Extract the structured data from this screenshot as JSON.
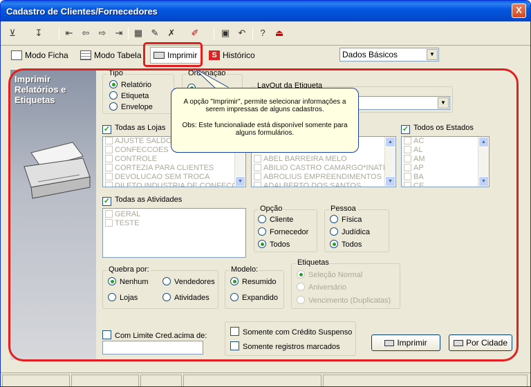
{
  "window": {
    "title": "Cadastro de Clientes/Fornecedores",
    "close_glyph": "X"
  },
  "toolbar": {
    "icons": [
      "filter-icon",
      "sort-icon",
      "first-icon",
      "prev-icon",
      "next-icon",
      "last-icon",
      "calculator-icon",
      "edit-icon",
      "delete-icon",
      "brush-icon",
      "save-icon",
      "undo-icon",
      "help-icon",
      "exit-icon"
    ]
  },
  "tabs": {
    "modo_ficha": "Modo Ficha",
    "modo_tabela": "Modo Tabela",
    "imprimir": "Imprimir",
    "historico": "Histórico"
  },
  "view_select": {
    "value": "Dados Básicos"
  },
  "side_panel": {
    "line1": "Imprimir",
    "line2": "Relatórios e",
    "line3": "Etiquetas"
  },
  "tipo": {
    "label": "Tipo",
    "options": [
      "Relatório",
      "Etiqueta",
      "Envelope"
    ],
    "selected": "Relatório"
  },
  "ordenacao": {
    "label": "Ordenação"
  },
  "layout": {
    "label": "LayOut da Etiqueta",
    "value": ""
  },
  "tooltip": {
    "line1": "A opção \"Imprimir\", permite selecionar informações a serem impressas de alguns cadastros.",
    "line2": "Obs: Este funcionaliade está disponível somente para alguns formulários."
  },
  "lojas": {
    "check_label": "Todas as Lojas",
    "checked": true,
    "items": [
      "AJUSTE SALDO",
      "CONFECCOES",
      "CONTROLE",
      "CORTEZIA PARA CLIENTES",
      "DEVOLUCAO SEM TROCA",
      "DILETO INDUSTRIA DE CONFECC"
    ]
  },
  "clientes": {
    "items": [
      "ABEL BARREIRA MELO",
      "ABILIO CASTRO CAMARGO*INATIV",
      "ABROLIUS EMPREENDIMENTOS LT",
      "ADALBERTO DOS SANTOS"
    ]
  },
  "estados": {
    "check_label": "Todos os Estados",
    "checked": true,
    "items": [
      "AC",
      "AL",
      "AM",
      "AP",
      "BA",
      "CE"
    ]
  },
  "atividades": {
    "check_label": "Todas as Atividades",
    "checked": true,
    "items": [
      "GERAL",
      "TESTE"
    ]
  },
  "opcao": {
    "label": "Opção",
    "options": [
      "Cliente",
      "Fornecedor",
      "Todos"
    ],
    "selected": "Todos"
  },
  "pessoa": {
    "label": "Pessoa",
    "options": [
      "Física",
      "Judídica",
      "Todos"
    ],
    "selected": "Todos"
  },
  "quebra": {
    "label": "Quebra por:",
    "options": [
      "Nenhum",
      "Vendedores",
      "Lojas",
      "Atividades"
    ],
    "selected": "Nenhum"
  },
  "modelo": {
    "label": "Modelo:",
    "options": [
      "Resumido",
      "Expandido"
    ],
    "selected": "Resumido"
  },
  "etiquetas": {
    "label": "Etiquetas",
    "options": [
      "Seleção Normal",
      "Aniversário",
      "Vencimento (Duplicatas)"
    ],
    "selected": "Seleção Normal"
  },
  "limite": {
    "check_label": "Com Limite Cred.acima de:",
    "checked": false,
    "value": ""
  },
  "credito_suspenso": {
    "label": "Somente com Crédito Suspenso",
    "checked": false
  },
  "registros_marcados": {
    "label": "Somente registros marcados",
    "checked": false
  },
  "buttons": {
    "imprimir": "Imprimir",
    "por_cidade": "Por Cidade"
  },
  "colors": {
    "highlight": "#e02020",
    "titlebar": "#0458e0",
    "radio_dot": "#21a121"
  }
}
